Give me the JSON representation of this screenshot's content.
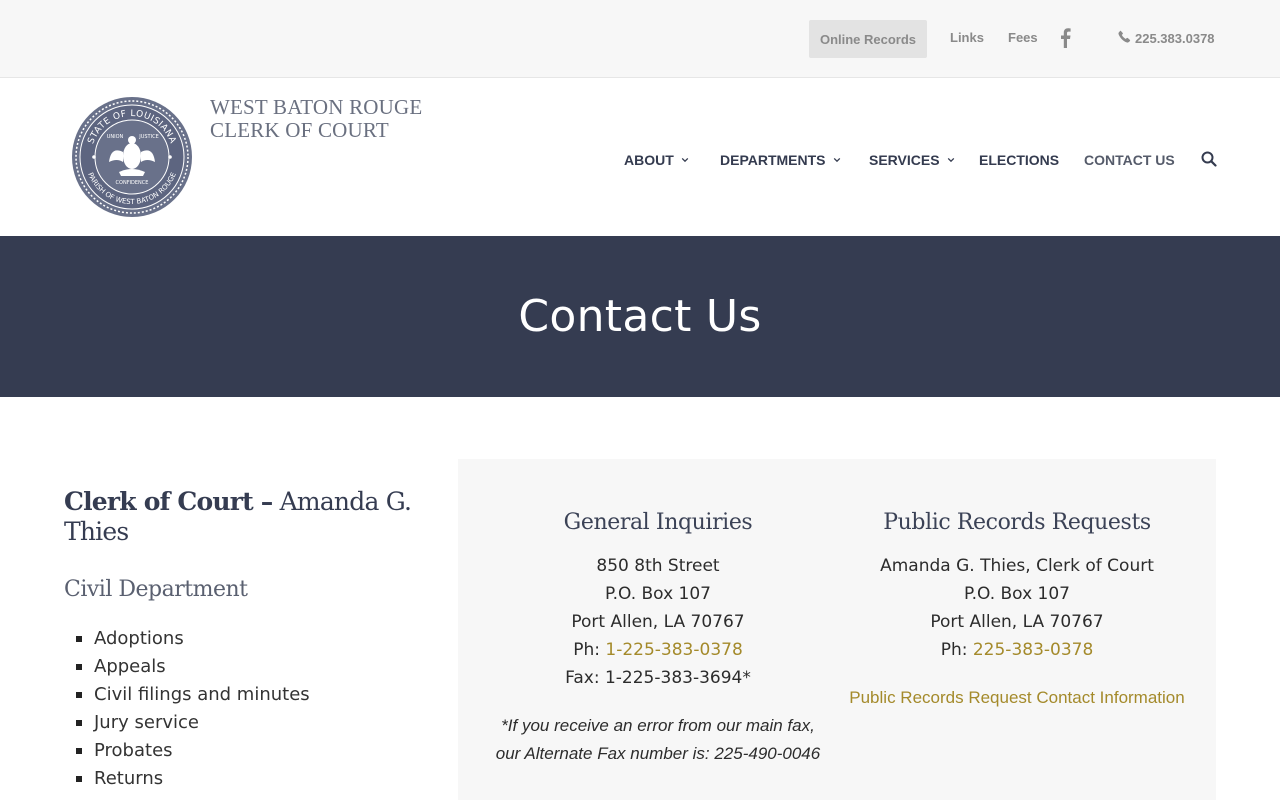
{
  "topbar": {
    "online_records": "Online Records",
    "links": "Links",
    "fees": "Fees",
    "facebook_icon": "facebook-icon",
    "phone": "225.383.0378"
  },
  "brand": {
    "line1": "WEST BATON ROUGE",
    "line2": "CLERK OF COURT",
    "seal": {
      "top_text": "STATE OF LOUISIANA",
      "bottom_text": "PARISH OF WEST BATON ROUGE",
      "motto_left": "UNION",
      "motto_right": "JUSTICE",
      "motto_bottom": "CONFIDENCE"
    }
  },
  "nav": {
    "items": [
      {
        "label": "ABOUT",
        "has_dropdown": true
      },
      {
        "label": "DEPARTMENTS",
        "has_dropdown": true
      },
      {
        "label": "SERVICES",
        "has_dropdown": true
      },
      {
        "label": "ELECTIONS",
        "has_dropdown": false
      },
      {
        "label": "CONTACT US",
        "has_dropdown": false
      }
    ],
    "search_icon": "search-icon"
  },
  "hero": {
    "title": "Contact Us"
  },
  "left": {
    "clerk_label": "Clerk of Court –",
    "clerk_name": "Amanda G. Thies",
    "department": "Civil Department",
    "services": [
      "Adoptions",
      "Appeals",
      "Civil filings and minutes",
      "Jury service",
      "Probates",
      "Returns"
    ]
  },
  "general": {
    "heading": "General Inquiries",
    "address1": "850 8th Street",
    "address2": "P.O. Box 107",
    "address3": "Port Allen, LA 70767",
    "phone_label": "Ph:",
    "phone": "1-225-383-0378",
    "fax": "Fax: 1-225-383-3694*",
    "note": "*If you receive an error from our main fax, our Alternate Fax number is: 225-490-0046"
  },
  "records": {
    "heading": "Public Records Requests",
    "line1": "Amanda G. Thies, Clerk of Court",
    "line2": "P.O. Box 107",
    "line3": "Port Allen, LA 70767",
    "phone_label": "Ph:",
    "phone": "225-383-0378",
    "link": "Public Records Request Contact Information"
  },
  "colors": {
    "navy": "#353c51",
    "gold_link": "#a48a2b",
    "topbar_bg": "#f7f7f7",
    "card_bg": "#f7f7f7"
  }
}
